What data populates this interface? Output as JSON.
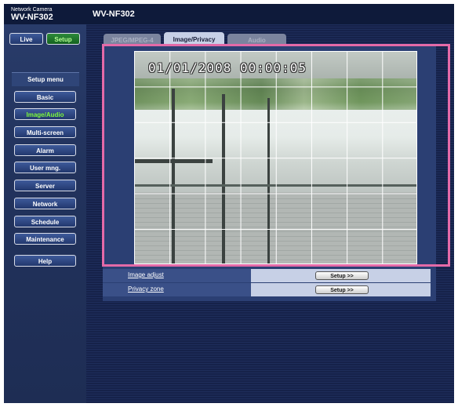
{
  "brand": {
    "subtitle": "Network Camera",
    "model": "WV-NF302"
  },
  "header": {
    "title": "WV-NF302"
  },
  "mode_buttons": {
    "live": "Live",
    "setup": "Setup"
  },
  "menu": {
    "heading": "Setup menu",
    "items": [
      {
        "label": "Basic"
      },
      {
        "label": "Image/Audio"
      },
      {
        "label": "Multi-screen"
      },
      {
        "label": "Alarm"
      },
      {
        "label": "User mng."
      },
      {
        "label": "Server"
      },
      {
        "label": "Network"
      },
      {
        "label": "Schedule"
      },
      {
        "label": "Maintenance"
      }
    ],
    "help": "Help"
  },
  "tabs": [
    {
      "label": "JPEG/MPEG-4"
    },
    {
      "label": "Image/Privacy"
    },
    {
      "label": "Audio"
    }
  ],
  "camera": {
    "timestamp": "01/01/2008 00:00:05"
  },
  "settings": [
    {
      "label": "Image adjust",
      "button": "Setup >>"
    },
    {
      "label": "Privacy zone",
      "button": "Setup >>"
    }
  ],
  "colors": {
    "highlight": "#e46aa8",
    "active_tab": "#c7d0e6",
    "selected_menu_text": "#7dfc3a"
  }
}
